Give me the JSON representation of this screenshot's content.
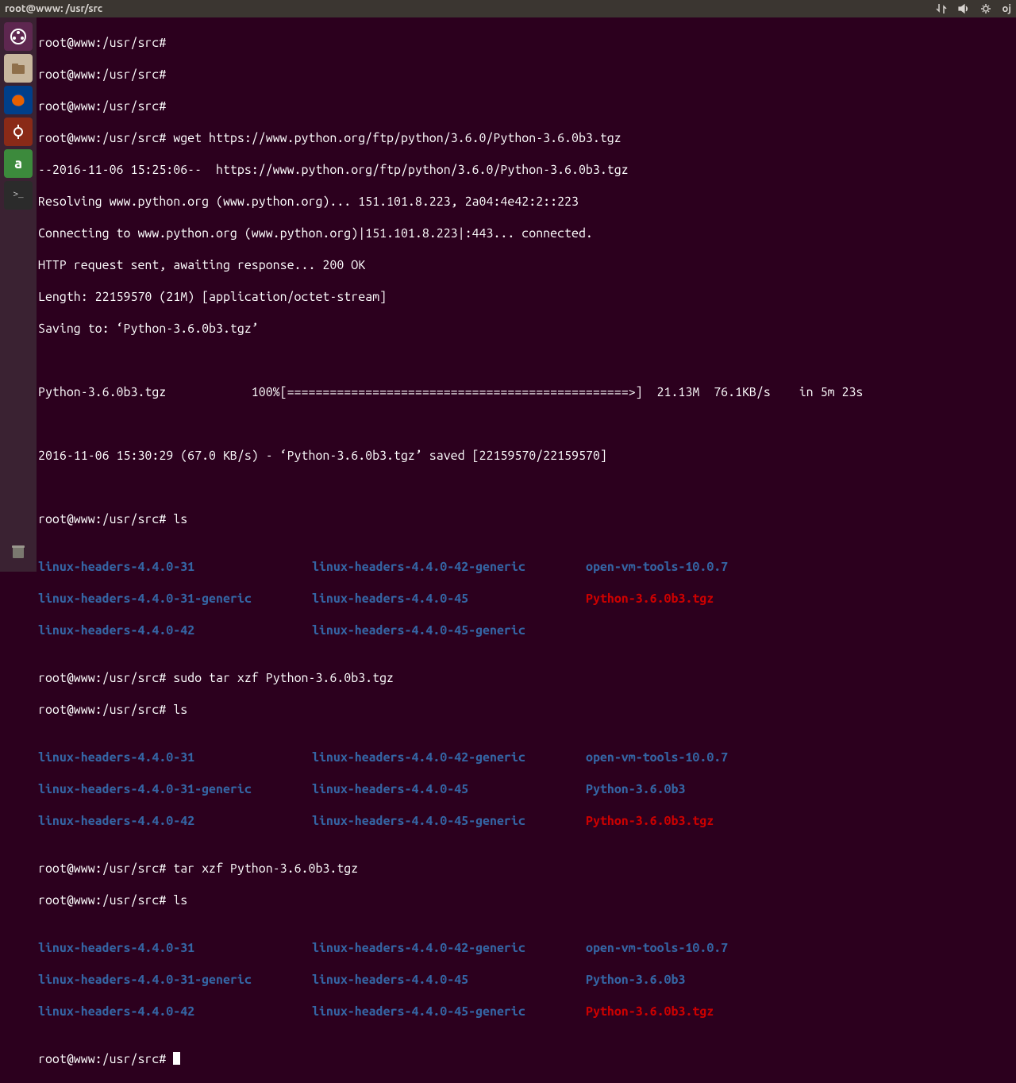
{
  "topbar": {
    "title": "root@www: /usr/src",
    "user": "oj"
  },
  "launcher": {
    "items": [
      {
        "name": "dash-icon",
        "bg": "#dd4814",
        "glyph": "◐"
      },
      {
        "name": "files-icon",
        "bg": "#8f5536",
        "glyph": "🗂"
      },
      {
        "name": "firefox-icon",
        "bg": "#0060df",
        "glyph": "🦊"
      },
      {
        "name": "software-icon",
        "bg": "#a33c1f",
        "glyph": "⚙"
      },
      {
        "name": "amazon-icon",
        "bg": "#3c8a3c",
        "glyph": "a"
      },
      {
        "name": "terminal-icon",
        "bg": "#2b2b2b",
        "glyph": ">_"
      }
    ],
    "trash": "🗑"
  },
  "term": {
    "prompt": "root@www:/usr/src#",
    "cmd_wget": "wget https://www.python.org/ftp/python/3.6.0/Python-3.6.0b3.tgz",
    "wget1": "--2016-11-06 15:25:06--  https://www.python.org/ftp/python/3.6.0/Python-3.6.0b3.tgz",
    "wget2": "Resolving www.python.org (www.python.org)... 151.101.8.223, 2a04:4e42:2::223",
    "wget3": "Connecting to www.python.org (www.python.org)|151.101.8.223|:443... connected.",
    "wget4": "HTTP request sent, awaiting response... 200 OK",
    "wget5": "Length: 22159570 (21M) [application/octet-stream]",
    "wget6": "Saving to: ‘Python-3.6.0b3.tgz’",
    "progress": "Python-3.6.0b3.tgz            100%[================================================>]  21.13M  76.1KB/s    in 5m 23s",
    "wget7": "2016-11-06 15:30:29 (67.0 KB/s) - ‘Python-3.6.0b3.tgz’ saved [22159570/22159570]",
    "cmd_ls": "ls",
    "cmd_sudotar": "sudo tar xzf Python-3.6.0b3.tgz",
    "cmd_tar": "tar xzf Python-3.6.0b3.tgz",
    "ls1": {
      "r1c1": "linux-headers-4.4.0-31",
      "r1c2": "linux-headers-4.4.0-42-generic",
      "r1c3": "open-vm-tools-10.0.7",
      "r2c1": "linux-headers-4.4.0-31-generic",
      "r2c2": "linux-headers-4.4.0-45",
      "r2c3": "Python-3.6.0b3.tgz",
      "r3c1": "linux-headers-4.4.0-42",
      "r3c2": "linux-headers-4.4.0-45-generic"
    },
    "ls2": {
      "r1c1": "linux-headers-4.4.0-31",
      "r1c2": "linux-headers-4.4.0-42-generic",
      "r1c3": "open-vm-tools-10.0.7",
      "r2c1": "linux-headers-4.4.0-31-generic",
      "r2c2": "linux-headers-4.4.0-45",
      "r2c3": "Python-3.6.0b3",
      "r3c1": "linux-headers-4.4.0-42",
      "r3c2": "linux-headers-4.4.0-45-generic",
      "r3c3": "Python-3.6.0b3.tgz"
    }
  }
}
